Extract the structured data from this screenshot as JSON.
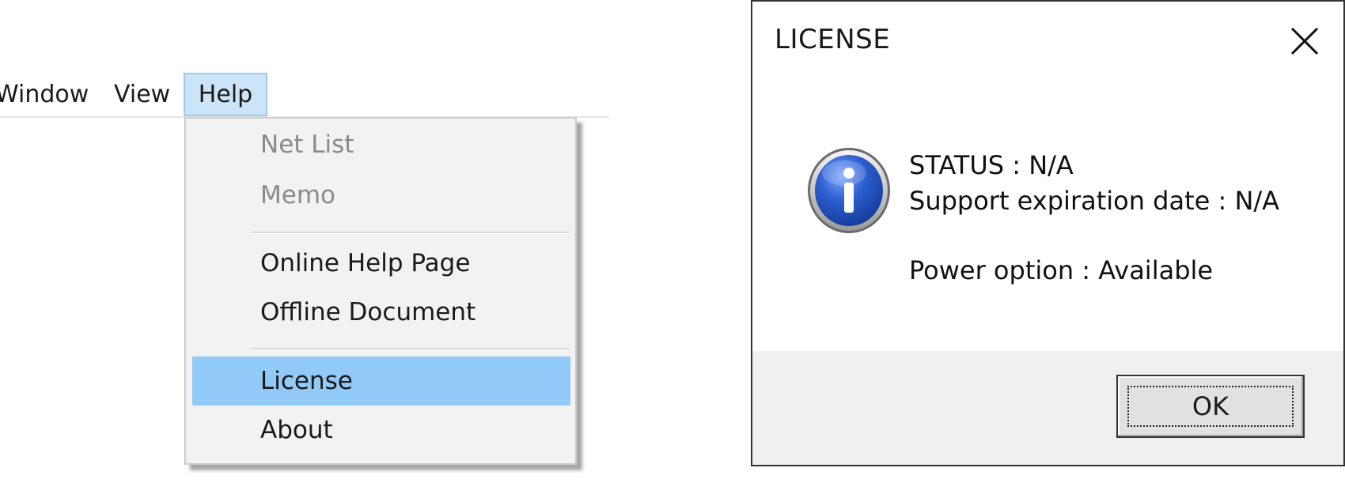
{
  "menubar": {
    "items": [
      {
        "label": "Window"
      },
      {
        "label": "View"
      },
      {
        "label": "Help",
        "state": "open"
      }
    ]
  },
  "help_menu": {
    "items": [
      {
        "label": "Net List",
        "enabled": false
      },
      {
        "label": "Memo",
        "enabled": false
      },
      {
        "label": "Online Help Page",
        "enabled": true
      },
      {
        "label": "Offline Document",
        "enabled": true
      },
      {
        "label": "License",
        "enabled": true,
        "highlighted": true
      },
      {
        "label": "About",
        "enabled": true
      }
    ]
  },
  "dialog": {
    "title": "LICENSE",
    "icon": "info-icon",
    "status_line": "STATUS : N/A",
    "support_line": "Support expiration date : N/A",
    "power_line": "Power option : Available",
    "ok_label": "OK"
  },
  "colors": {
    "menu_highlight": "#91c9f7",
    "menubar_active_bg": "#cce4f7",
    "menu_bg": "#f2f2f2",
    "disabled_text": "#8a8a8a",
    "dialog_footer_bg": "#f0f0f0",
    "info_icon_blue": "#1f4fb8"
  }
}
